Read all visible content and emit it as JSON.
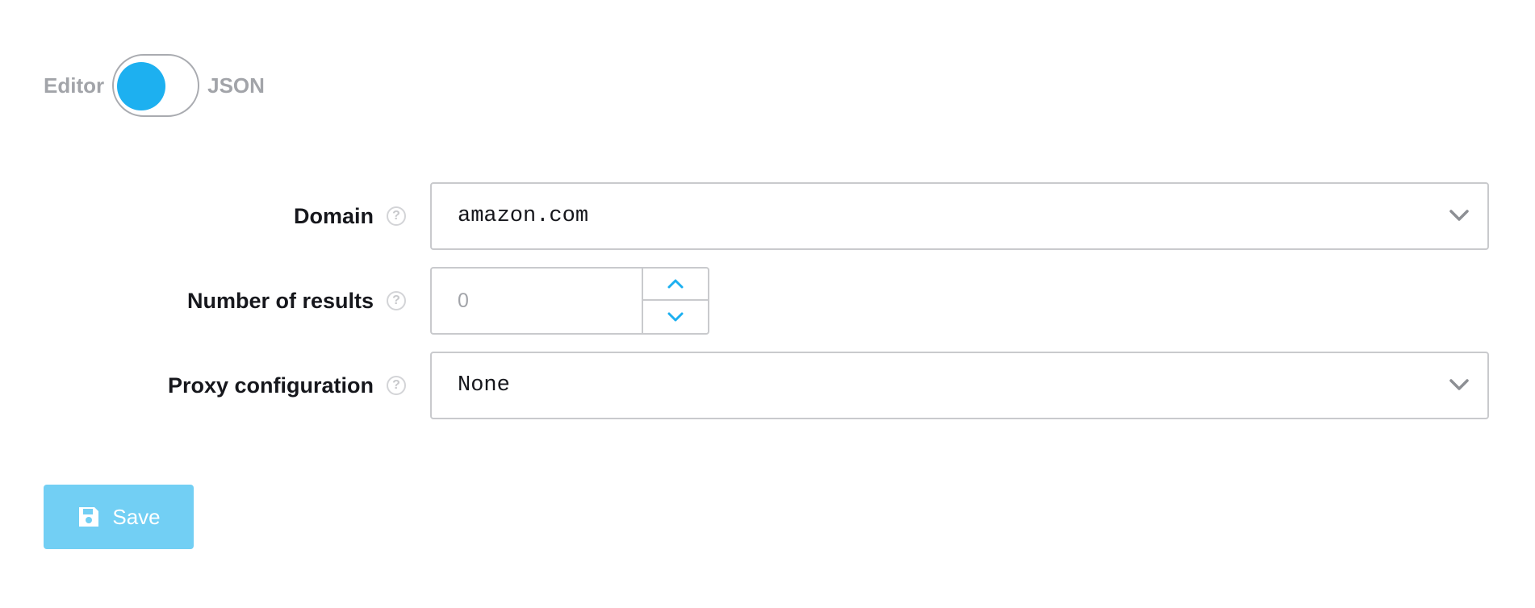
{
  "mode_toggle": {
    "left_label": "Editor",
    "right_label": "JSON"
  },
  "form": {
    "domain": {
      "label": "Domain",
      "value": "amazon.com"
    },
    "number_of_results": {
      "label": "Number of results",
      "placeholder": "0"
    },
    "proxy_configuration": {
      "label": "Proxy configuration",
      "value": "None"
    },
    "help_glyph": "?"
  },
  "actions": {
    "save_label": "Save"
  },
  "icons": {
    "select_chevron": "chevron-down-icon",
    "stepper_up": "chevron-up-icon",
    "stepper_down": "chevron-down-icon",
    "save": "floppy-disk-icon",
    "help": "question-mark-icon"
  },
  "colors": {
    "accent": "#1db0f0",
    "save_button_bg": "#72cff4",
    "muted_text": "#a2a4a9",
    "border": "#c9cacd"
  }
}
